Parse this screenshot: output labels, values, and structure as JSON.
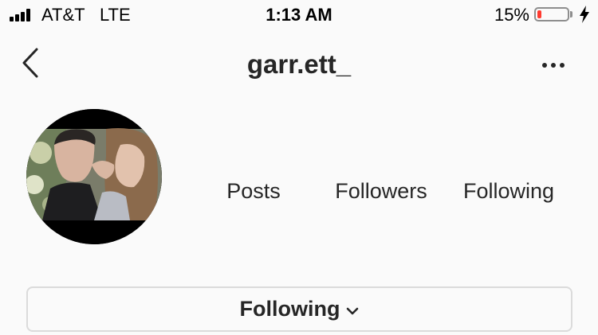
{
  "status_bar": {
    "carrier": "AT&T",
    "network": "LTE",
    "time": "1:13 AM",
    "battery_percent": "15%",
    "battery_level": 0.15,
    "battery_color": "#ff3b30",
    "charging": true
  },
  "header": {
    "username": "garr.ett_",
    "back_icon": "chevron-left-icon",
    "more_icon": "more-horizontal-icon"
  },
  "profile": {
    "avatar": "profile-photo",
    "stats": {
      "posts_label": "Posts",
      "followers_label": "Followers",
      "following_label": "Following"
    },
    "follow_button": {
      "label": "Following",
      "icon": "chevron-down-icon"
    }
  }
}
